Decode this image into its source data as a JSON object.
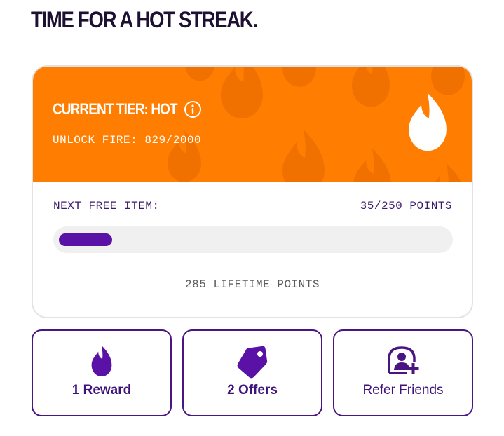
{
  "headline": "TIME FOR A HOT STREAK.",
  "tier": {
    "title": "CURRENT TIER: HOT",
    "unlock_text": "UNLOCK FIRE: 829/2000",
    "info_icon": "info-icon",
    "flame_icon": "flame-icon",
    "banner_color": "#ff7d00"
  },
  "progress": {
    "label": "NEXT FREE ITEM:",
    "points_text": "35/250 POINTS",
    "current": 35,
    "goal": 250,
    "fill_color": "#5a12a6",
    "lifetime_text": "285 LIFETIME POINTS"
  },
  "actions": [
    {
      "label": "1 Reward",
      "icon": "flame-icon"
    },
    {
      "label": "2 Offers",
      "icon": "tag-icon"
    },
    {
      "label": "Refer Friends",
      "icon": "add-friend-icon"
    }
  ],
  "colors": {
    "accent": "#3e137a",
    "text_dark": "#1e1033"
  }
}
